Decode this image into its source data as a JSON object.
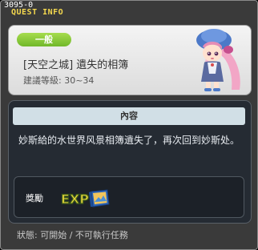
{
  "window": {
    "quest_id": "3095-0",
    "title": "QUEST INFO"
  },
  "header": {
    "category": "一般",
    "quest_name": "[天空之城] 遺失的相簿",
    "level": "建議等級: 30~34"
  },
  "content": {
    "heading": "內容",
    "description": "妙斯給的水世界风景相簿遺失了，再次回到妙斯处。"
  },
  "reward": {
    "label": "獎勵",
    "items": [
      {
        "icon": "exp-badge-icon",
        "text": "EXP"
      },
      {
        "icon": "album-book-icon"
      }
    ]
  },
  "status": {
    "text": "狀態: 可開始 / 不可執行任務"
  },
  "colors": {
    "title": "#f4d84e",
    "category_pill": "#8ccc3c",
    "content_bg": "#252b33",
    "content_header_bg": "#d1dfe6"
  }
}
